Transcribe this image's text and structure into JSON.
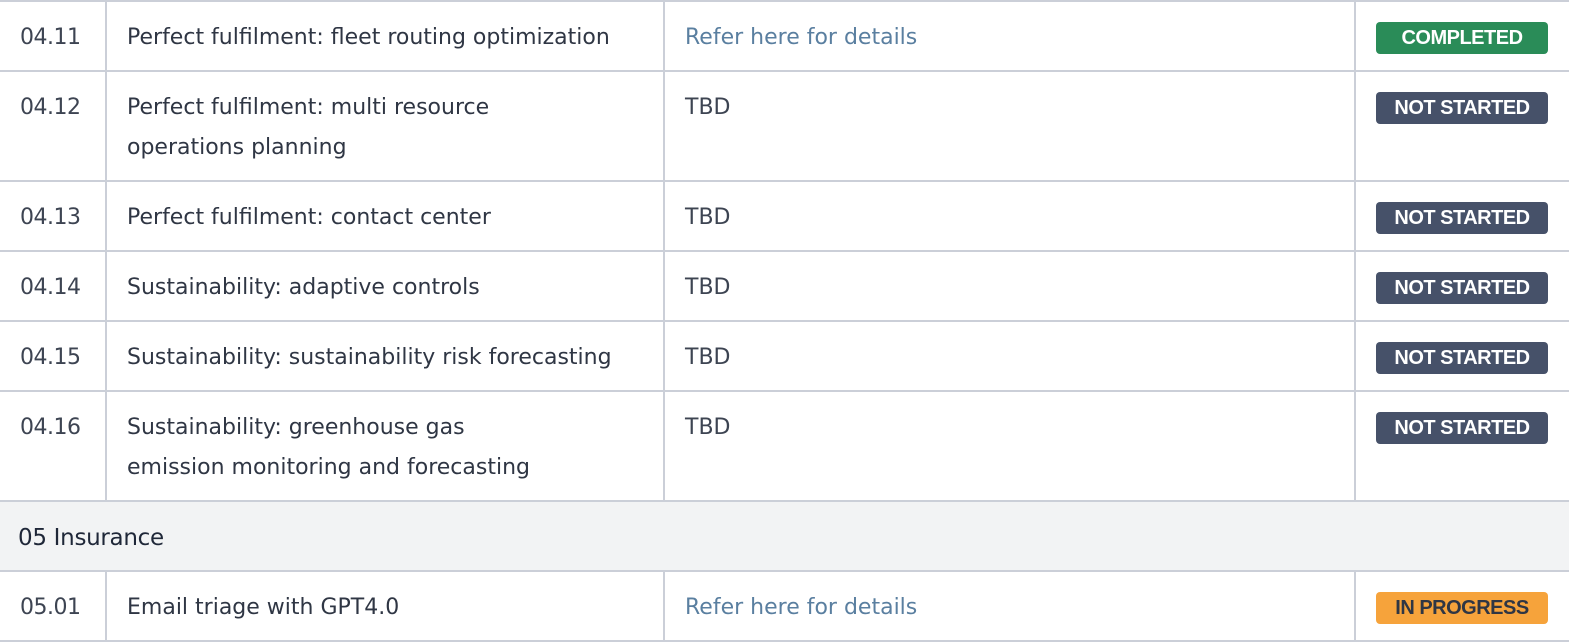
{
  "rows": [
    {
      "id": "04.11",
      "name_lines": [
        "Perfect fulfilment: fleet routing optimization",
        ""
      ],
      "link": "Refer here for details",
      "status": "COMPLETED"
    },
    {
      "id": "04.12",
      "name_lines": [
        "Perfect fulfilment: multi resource",
        "operations planning"
      ],
      "link": "TBD",
      "status": "NOT STARTED"
    },
    {
      "id": "04.13",
      "name_lines": [
        "Perfect fulfilment: contact center",
        ""
      ],
      "link": "TBD",
      "status": "NOT STARTED"
    },
    {
      "id": "04.14",
      "name_lines": [
        "Sustainability: adaptive controls",
        ""
      ],
      "link": "TBD",
      "status": "NOT STARTED"
    },
    {
      "id": "04.15",
      "name_lines": [
        "Sustainability: sustainability risk forecasting",
        ""
      ],
      "link": "TBD",
      "status": "NOT STARTED"
    },
    {
      "id": "04.16",
      "name_lines": [
        "Sustainability: greenhouse gas",
        "emission monitoring and forecasting"
      ],
      "link": "TBD",
      "status": "NOT STARTED"
    }
  ],
  "section": {
    "title": "05 Insurance"
  },
  "rows_after": [
    {
      "id": "05.01",
      "name_lines": [
        "Email triage with GPT4.0",
        ""
      ],
      "link": "Refer here for details",
      "status": "IN PROGRESS"
    }
  ],
  "colors": {
    "completed": "#2a8c58",
    "not_started": "#465169",
    "in_progress": "#f6a33b",
    "link": "#5a7fa0",
    "section_bg": "#f2f3f4",
    "border": "#cbcfd8"
  }
}
